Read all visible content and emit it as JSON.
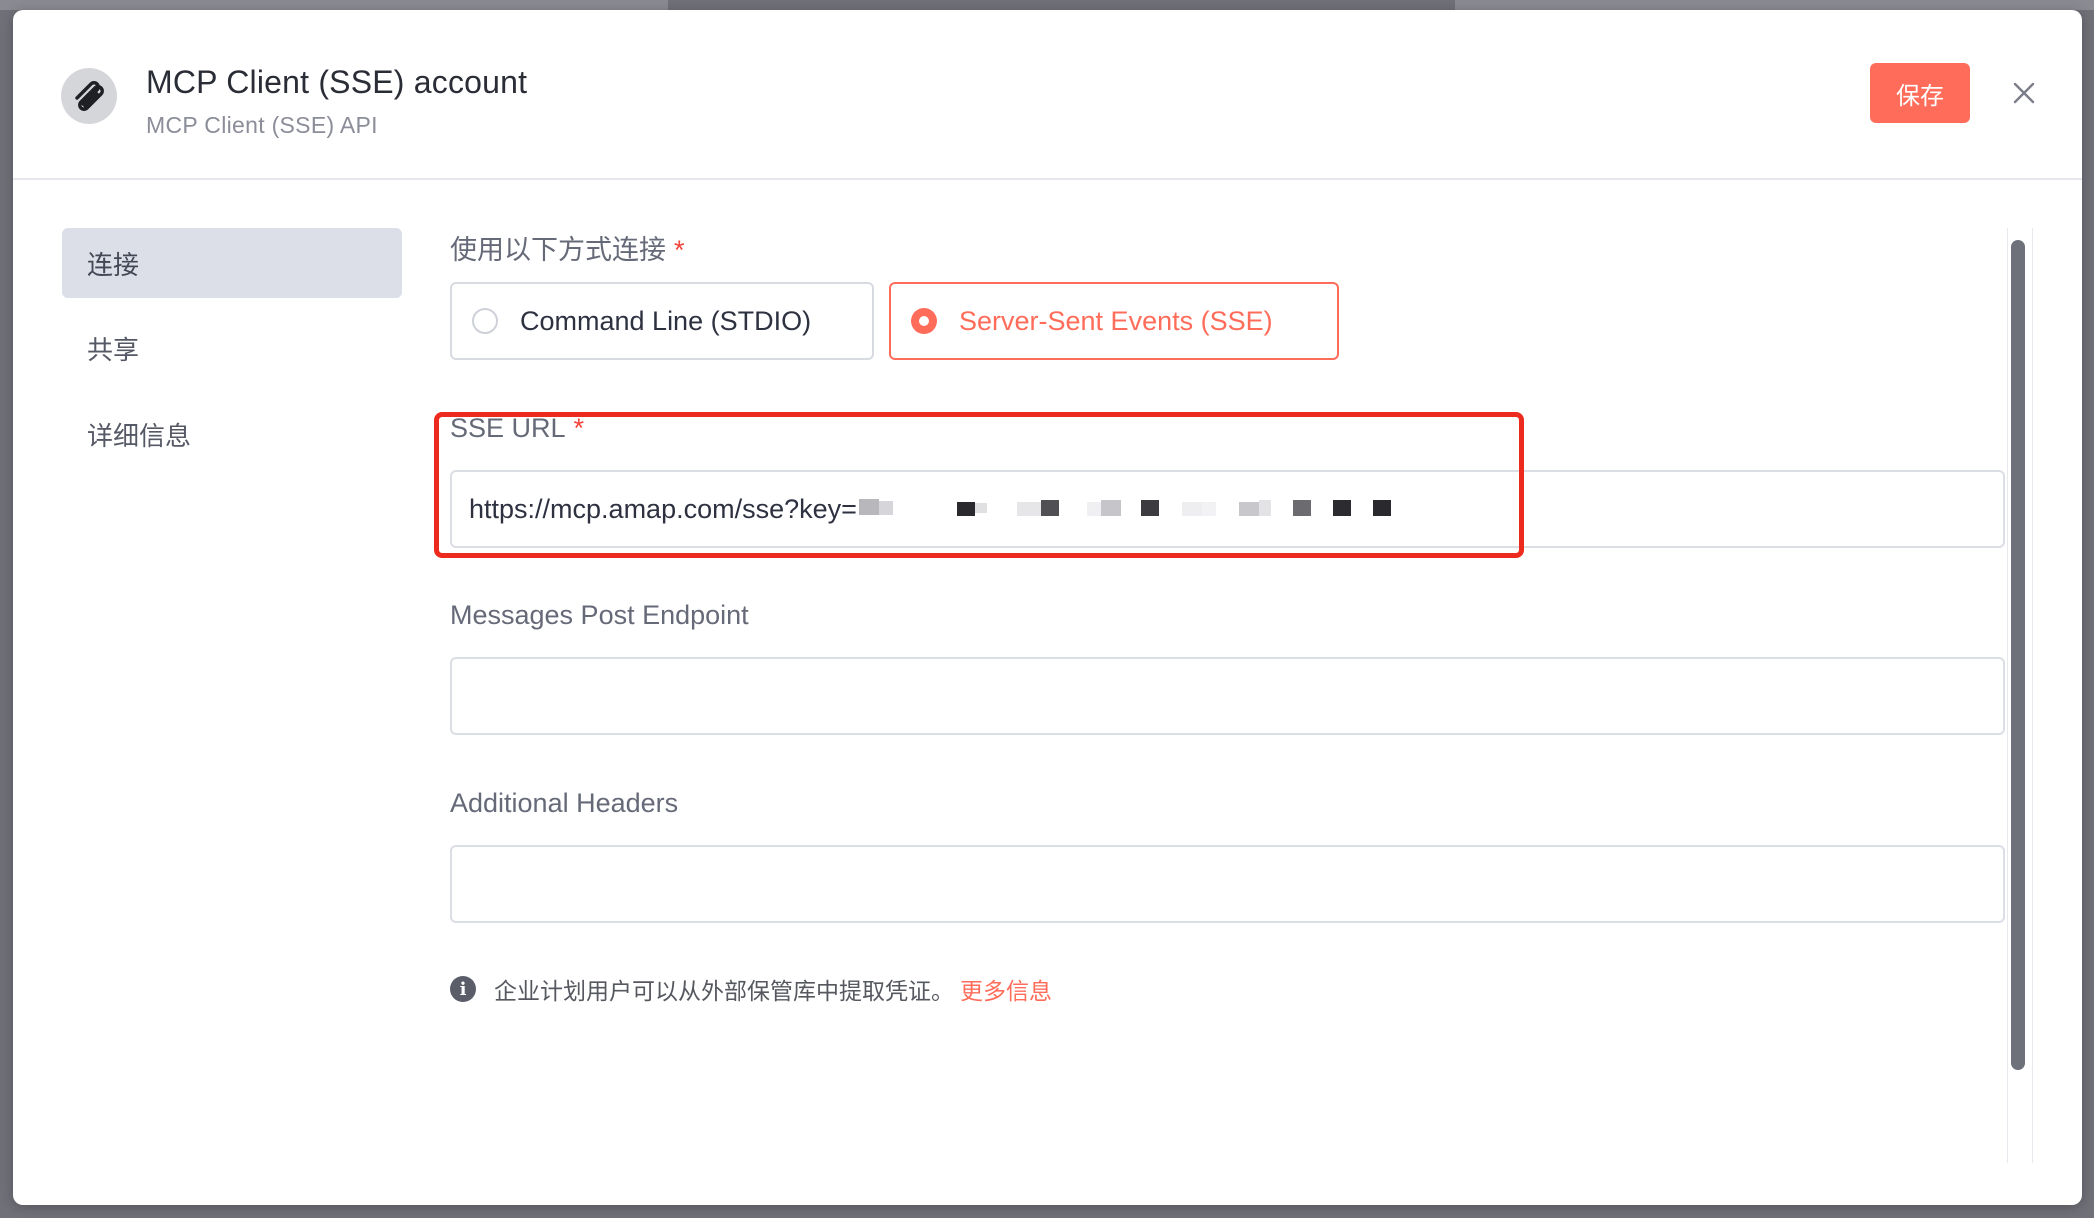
{
  "header": {
    "title": "MCP Client (SSE) account",
    "subtitle": "MCP Client (SSE) API",
    "save_label": "保存",
    "close_icon": "close-icon",
    "app_icon": "mcp-logo-icon"
  },
  "sidebar": {
    "items": [
      {
        "label": "连接",
        "active": true
      },
      {
        "label": "共享",
        "active": false
      },
      {
        "label": "详细信息",
        "active": false
      }
    ]
  },
  "form": {
    "connect_label": "使用以下方式连接",
    "required_mark": "*",
    "options": [
      {
        "label": "Command Line (STDIO)",
        "selected": false
      },
      {
        "label": "Server-Sent Events (SSE)",
        "selected": true
      }
    ],
    "sse_url_label": "SSE URL",
    "sse_url_value": "https://mcp.amap.com/sse?key=",
    "messages_label": "Messages Post Endpoint",
    "messages_value": "",
    "headers_label": "Additional Headers",
    "headers_value": ""
  },
  "info": {
    "icon": "info-icon",
    "text": "企业计划用户可以从外部保管库中提取凭证。",
    "link": "更多信息"
  },
  "colors": {
    "accent": "#ff6d5a",
    "highlight_box": "#ec2a1e",
    "active_tab_bg": "#dcdfe8"
  }
}
